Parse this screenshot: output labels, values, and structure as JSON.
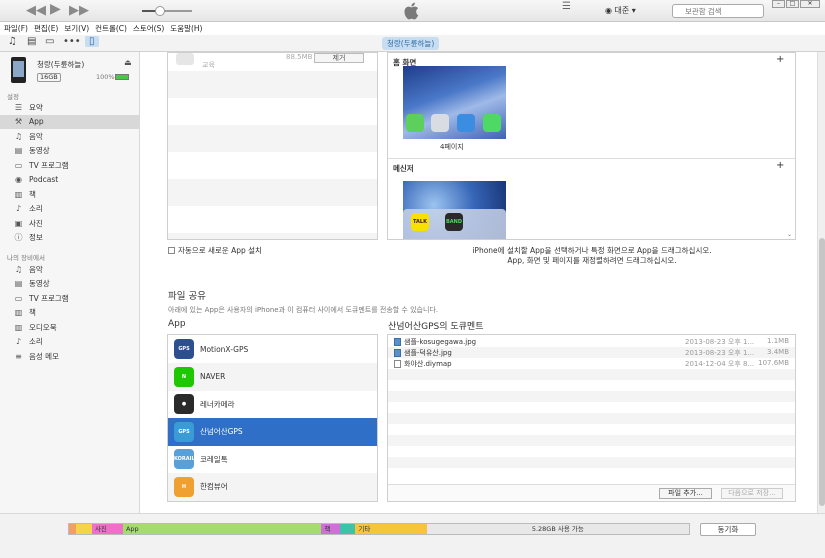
{
  "player": {
    "controls": [
      "rewind-icon",
      "play-icon",
      "fast-forward-icon"
    ],
    "volume_level": 0.35,
    "account": "대준",
    "search_placeholder": "보관함 검색"
  },
  "menu": [
    "파일(F)",
    "편집(E)",
    "보기(V)",
    "컨트롤(C)",
    "스토어(S)",
    "도움말(H)"
  ],
  "toolbar": {
    "icons": [
      "music-icon",
      "movies-icon",
      "tv-icon",
      "more-icon",
      "iphone-icon"
    ],
    "device_tag": "청랑(두륜하늘)"
  },
  "sidebar": {
    "device_name": "청랑(두륜하늘)",
    "capacity": "16GB",
    "battery": "100%",
    "section_settings": "설정",
    "settings_items": [
      {
        "icon": "summary-icon",
        "label": "요약"
      },
      {
        "icon": "app-icon",
        "label": "App"
      },
      {
        "icon": "music-icon",
        "label": "음악"
      },
      {
        "icon": "movies-icon",
        "label": "동영상"
      },
      {
        "icon": "tv-icon",
        "label": "TV 프로그램"
      },
      {
        "icon": "podcast-icon",
        "label": "Podcast"
      },
      {
        "icon": "books-icon",
        "label": "책"
      },
      {
        "icon": "tones-icon",
        "label": "소리"
      },
      {
        "icon": "photos-icon",
        "label": "사진"
      },
      {
        "icon": "info-icon",
        "label": "정보"
      }
    ],
    "section_device": "나의 장비에서",
    "device_items": [
      {
        "icon": "music-icon",
        "label": "음악"
      },
      {
        "icon": "movies-icon",
        "label": "동영상"
      },
      {
        "icon": "tv-icon",
        "label": "TV 프로그램"
      },
      {
        "icon": "books-icon",
        "label": "책"
      },
      {
        "icon": "audiobook-icon",
        "label": "오디오북"
      },
      {
        "icon": "tones-icon",
        "label": "소리"
      },
      {
        "icon": "voice-memo-icon",
        "label": "음성 메모"
      }
    ]
  },
  "apps_panel": {
    "partial_row_size": "88.5MB",
    "partial_row_category": "교육",
    "remove_label": "제거"
  },
  "home_screens": {
    "home_title": "홈 화면",
    "page_label": "4페이지",
    "messenger_title": "메신저",
    "icon_labels": [
      "TALK",
      "BAND"
    ],
    "hint_line1": "iPhone에 설치할 App을 선택하거나 특정 화면으로 App을 드래그하십시오.",
    "hint_line2": "App, 화면 및 페이지를 재정렬하려면 드래그하십시오."
  },
  "auto_install_label": "자동으로 새로운 App 설치",
  "file_sharing": {
    "title": "파일 공유",
    "description": "아래에 있는 App은 사용자의 iPhone과 이 컴퓨터 사이에서 도큐멘트를 전송할 수 있습니다.",
    "apps_title": "App",
    "docs_title": "산넘어산GPS의 도큐멘트",
    "apps": [
      {
        "name": "MotionX-GPS",
        "color": "#2d4f8f",
        "icon_text": "GPS"
      },
      {
        "name": "NAVER",
        "color": "#1ec800",
        "icon_text": "N"
      },
      {
        "name": "레너카메라",
        "color": "#2a2a2a",
        "icon_text": "●"
      },
      {
        "name": "산넘어산GPS",
        "color": "#3a9bd5",
        "icon_text": "GPS"
      },
      {
        "name": "코레일톡",
        "color": "#5aa0d8",
        "icon_text": "KORAIL"
      },
      {
        "name": "한컴뷰어",
        "color": "#f0a030",
        "icon_text": "H"
      }
    ],
    "selected_app_index": 3,
    "documents": [
      {
        "name": "샘플-kosugegawa.jpg",
        "date": "2013-08-23 오후 1...",
        "size": "1.1MB",
        "type": "image"
      },
      {
        "name": "샘플-덕유산.jpg",
        "date": "2013-08-23 오후 1...",
        "size": "3.4MB",
        "type": "image"
      },
      {
        "name": "화야산.diymap",
        "date": "2014-12-04 오후 8...",
        "size": "107.6MB",
        "type": "file"
      }
    ],
    "add_file_label": "파일 추가...",
    "save_to_label": "다음으로 저장..."
  },
  "capacity_bar": {
    "segments": [
      {
        "label": "",
        "color": "#f0a060",
        "fraction": 0.012
      },
      {
        "label": "",
        "color": "#f5d34a",
        "fraction": 0.025
      },
      {
        "label": "사진",
        "color": "#f070c8",
        "fraction": 0.05
      },
      {
        "label": "App",
        "color": "#a6dc6e",
        "fraction": 0.32
      },
      {
        "label": "책",
        "color": "#cf6fd8",
        "fraction": 0.03
      },
      {
        "label": "",
        "color": "#3cc4a8",
        "fraction": 0.025
      },
      {
        "label": "기타",
        "color": "#f5c63c",
        "fraction": 0.115
      },
      {
        "label": "5.28GB 사용 가능",
        "color": "#e8e8e8",
        "fraction": 0.423
      }
    ],
    "free_text": "5.28GB 사용 가능",
    "sync_label": "동기화"
  }
}
